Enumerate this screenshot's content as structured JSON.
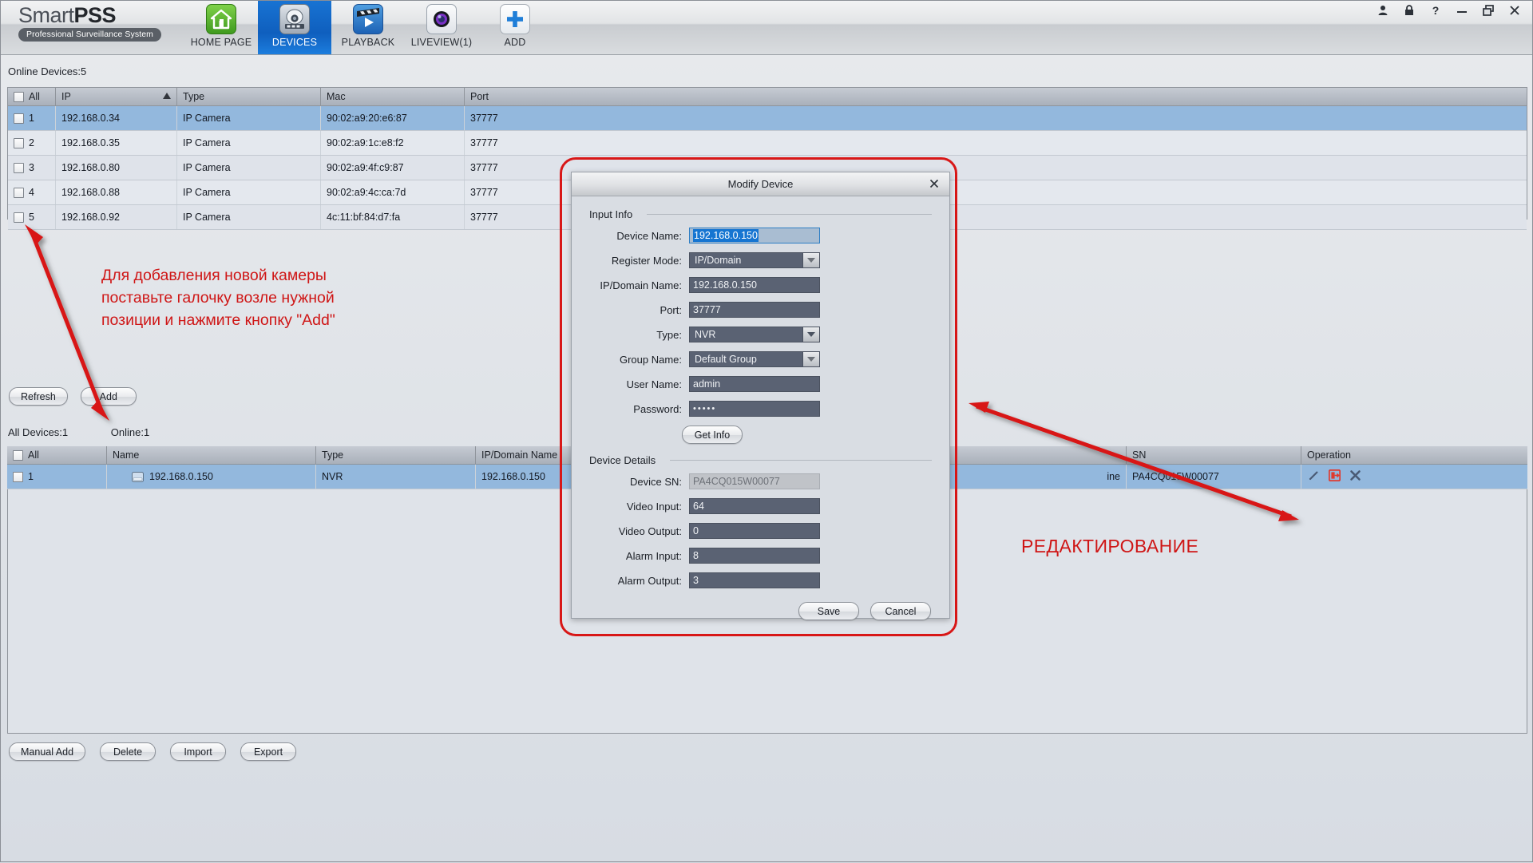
{
  "app": {
    "brand_light": "Smart",
    "brand_bold": "PSS",
    "tagline": "Professional Surveillance System",
    "accent_blue": "#1873d3",
    "annotation_red": "#cf1616"
  },
  "nav": {
    "tabs": [
      {
        "label": "HOME PAGE",
        "icon": "home-icon",
        "active": false
      },
      {
        "label": "DEVICES",
        "icon": "camera-dome-icon",
        "active": true
      },
      {
        "label": "PLAYBACK",
        "icon": "clapperboard-play-icon",
        "active": false
      },
      {
        "label": "LIVEVIEW(1)",
        "icon": "lens-icon",
        "active": false
      },
      {
        "label": "ADD",
        "icon": "plus-icon",
        "active": false
      }
    ]
  },
  "window_controls": [
    {
      "name": "user-icon"
    },
    {
      "name": "lock-icon"
    },
    {
      "name": "help-icon"
    },
    {
      "name": "minimize-icon"
    },
    {
      "name": "restore-icon"
    },
    {
      "name": "close-icon"
    }
  ],
  "online_panel": {
    "title": "Online Devices:5",
    "columns": [
      "All",
      "IP",
      "Type",
      "Mac",
      "Port"
    ],
    "sort_column": "IP",
    "sort_direction": "asc",
    "rows": [
      {
        "num": "1",
        "ip": "192.168.0.34",
        "type": "IP Camera",
        "mac": "90:02:a9:20:e6:87",
        "port": "37777",
        "selected": true
      },
      {
        "num": "2",
        "ip": "192.168.0.35",
        "type": "IP Camera",
        "mac": "90:02:a9:1c:e8:f2",
        "port": "37777",
        "selected": false
      },
      {
        "num": "3",
        "ip": "192.168.0.80",
        "type": "IP Camera",
        "mac": "90:02:a9:4f:c9:87",
        "port": "37777",
        "selected": false
      },
      {
        "num": "4",
        "ip": "192.168.0.88",
        "type": "IP Camera",
        "mac": "90:02:a9:4c:ca:7d",
        "port": "37777",
        "selected": false
      },
      {
        "num": "5",
        "ip": "192.168.0.92",
        "type": "IP Camera",
        "mac": "4c:11:bf:84:d7:fa",
        "port": "37777",
        "selected": false
      }
    ],
    "buttons": {
      "refresh": "Refresh",
      "add": "Add"
    }
  },
  "all_devices_panel": {
    "count_label": "All Devices:1",
    "online_label": "Online:1",
    "columns": [
      "All",
      "Name",
      "Type",
      "IP/Domain Name",
      "SN",
      "Operation"
    ],
    "rows": [
      {
        "num": "1",
        "name": "192.168.0.150",
        "type": "NVR",
        "ip_domain": "192.168.0.150",
        "status_fragment": "ine",
        "sn": "PA4CQ015W00077",
        "selected": true,
        "operations": [
          "edit-pencil-icon",
          "export-device-icon",
          "delete-x-icon"
        ]
      }
    ],
    "buttons": {
      "manual_add": "Manual Add",
      "delete": "Delete",
      "import": "Import",
      "export": "Export"
    }
  },
  "dialog": {
    "title": "Modify Device",
    "close_icon": "close-icon",
    "sections": {
      "input_info": "Input Info",
      "device_details": "Device Details"
    },
    "fields": {
      "device_name": {
        "label": "Device Name:",
        "value": "192.168.0.150",
        "focused": true
      },
      "register_mode": {
        "label": "Register Mode:",
        "value": "IP/Domain"
      },
      "ip_domain_name": {
        "label": "IP/Domain Name:",
        "value": "192.168.0.150"
      },
      "port": {
        "label": "Port:",
        "value": "37777"
      },
      "type": {
        "label": "Type:",
        "value": "NVR"
      },
      "group_name": {
        "label": "Group Name:",
        "value": "Default Group"
      },
      "user_name": {
        "label": "User Name:",
        "value": "admin"
      },
      "password": {
        "label": "Password:",
        "value": "•••••"
      },
      "device_sn": {
        "label": "Device SN:",
        "value": "PA4CQ015W00077",
        "readonly": true
      },
      "video_input": {
        "label": "Video Input:",
        "value": "64"
      },
      "video_output": {
        "label": "Video Output:",
        "value": "0"
      },
      "alarm_input": {
        "label": "Alarm Input:",
        "value": "8"
      },
      "alarm_output": {
        "label": "Alarm Output:",
        "value": "3"
      }
    },
    "buttons": {
      "get_info": "Get Info",
      "save": "Save",
      "cancel": "Cancel"
    }
  },
  "annotations": {
    "add_camera_note": "Для добавления новой камеры поставьте галочку возле нужной позиции и нажмите кнопку \"Add\"",
    "add_camera_note_lines": [
      "Для добавления новой камеры",
      "поставьте галочку возле нужной",
      "позиции и нажмите кнопку \"Add\""
    ],
    "edit_note": "РЕДАКТИРОВАНИЕ"
  }
}
